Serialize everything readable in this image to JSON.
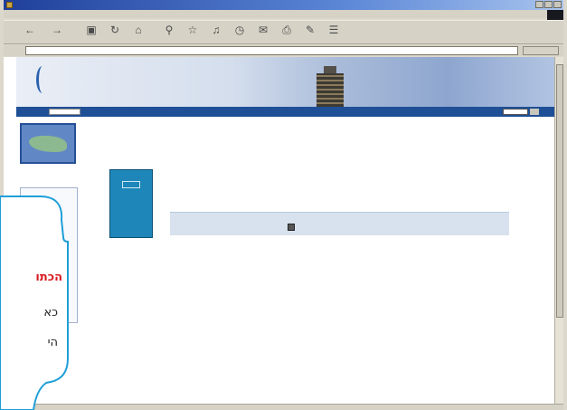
{
  "window": {
    "title": ""
  },
  "menubar": {
    "items": [
      "",
      "",
      "",
      "",
      "",
      "",
      ""
    ]
  },
  "toolbar": {
    "buttons": [
      {
        "icon": "back-arrow-icon",
        "label": ""
      },
      {
        "icon": "forward-arrow-icon",
        "label": ""
      },
      {
        "icon": "stop-icon",
        "label": ""
      },
      {
        "icon": "refresh-icon",
        "label": ""
      },
      {
        "icon": "home-icon",
        "label": ""
      },
      {
        "icon": "search-icon",
        "label": ""
      },
      {
        "icon": "favorites-icon",
        "label": ""
      },
      {
        "icon": "media-icon",
        "label": ""
      },
      {
        "icon": "history-icon",
        "label": ""
      },
      {
        "icon": "mail-icon",
        "label": ""
      },
      {
        "icon": "print-icon",
        "label": ""
      },
      {
        "icon": "edit-icon",
        "label": ""
      },
      {
        "icon": "discuss-icon",
        "label": ""
      }
    ]
  },
  "address": {
    "label": "",
    "url": "",
    "go": ""
  },
  "site": {
    "org_name": "",
    "search_go": "",
    "nav_links": "",
    "lang_label": "",
    "lang_value": ""
  },
  "sidebar": {
    "menu_title": "",
    "items": [
      "",
      "",
      "",
      "",
      "",
      ""
    ]
  },
  "main": {
    "breadcrumb": "",
    "heading": "",
    "pub_title": "",
    "pub_date": "",
    "availability": "",
    "info_line_1": "",
    "info_line_2": ""
  },
  "status": {
    "zone": ""
  },
  "callout": {
    "heading": "הכתו",
    "line1": "כא",
    "line2": "הי"
  }
}
